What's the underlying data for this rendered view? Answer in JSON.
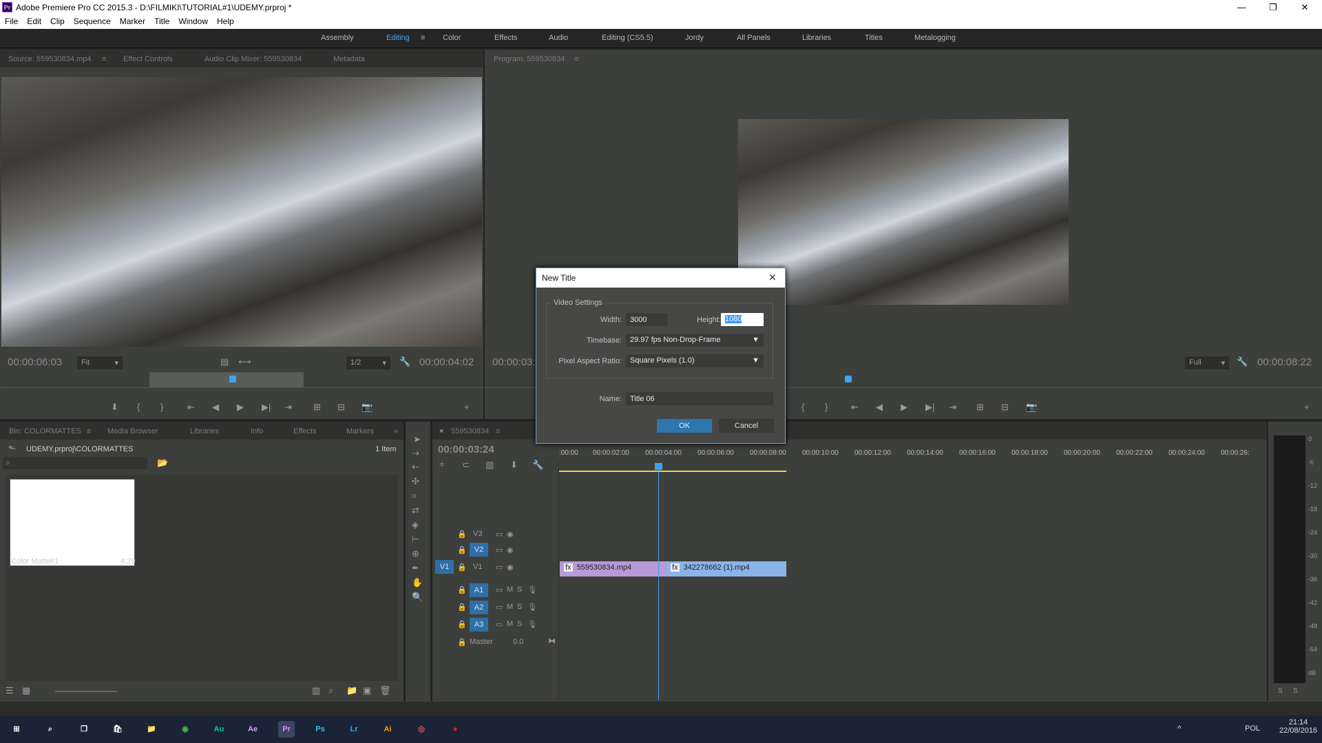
{
  "window": {
    "app_icon": "Pr",
    "title": "Adobe Premiere Pro CC 2015.3 - D:\\FILMIKI\\TUTORIAL#1\\UDEMY.prproj *",
    "minimize": "—",
    "restore": "❐",
    "close": "✕"
  },
  "menu": [
    "File",
    "Edit",
    "Clip",
    "Sequence",
    "Marker",
    "Title",
    "Window",
    "Help"
  ],
  "workspaces": {
    "items": [
      "Assembly",
      "Editing",
      "Color",
      "Effects",
      "Audio",
      "Editing (CS5.5)",
      "Jordy",
      "All Panels",
      "Libraries",
      "Titles",
      "Metalogging"
    ],
    "active": "Editing",
    "menu_icon": "≡"
  },
  "source_panel": {
    "tabs": [
      "Source: 559530834.mp4",
      "Effect Controls",
      "Audio Clip Mixer: 559530834",
      "Metadata"
    ],
    "tab_menu": "≡",
    "timecode_left": "00:00:06:03",
    "fit": "Fit",
    "resolution": "1/2",
    "timecode_right": "00:00:04:02",
    "playhead_fraction": 0.54
  },
  "program_panel": {
    "tab": "Program: 559530834",
    "tab_menu": "≡",
    "timecode_left": "00:00:03:",
    "fit": "Full",
    "timecode_right": "00:00:08:22"
  },
  "dialog": {
    "title": "New Title",
    "close": "✕",
    "group": "Video Settings",
    "width_label": "Width:",
    "width_value": "3000",
    "height_label": "Height:",
    "height_value": "1080",
    "timebase_label": "Timebase:",
    "timebase_value": "29.97 fps Non-Drop-Frame",
    "par_label": "Pixel Aspect Ratio:",
    "par_value": "Square Pixels (1.0)",
    "name_label": "Name:",
    "name_value": "Title 06",
    "ok": "OK",
    "cancel": "Cancel",
    "accent": "#2d77ad"
  },
  "project_panel": {
    "tabs": [
      "Bin: COLORMATTES",
      "Media Browser",
      "Libraries",
      "Info",
      "Effects",
      "Markers"
    ],
    "tab_menu": "≡",
    "overflow": "»",
    "path": "UDEMY.prproj\\COLORMATTES",
    "count": "1 Item",
    "items": [
      {
        "name": "Color Matte#1",
        "duration": "4:29",
        "color": "#ffffff"
      }
    ]
  },
  "timeline": {
    "tab": "559530834",
    "close": "×",
    "tab_menu": "≡",
    "timecode": "00:00:03:24",
    "ruler": [
      ":00:00",
      "00:00:02:00",
      "00:00:04:00",
      "00:00:06:00",
      "00:00:08:00",
      "00:00:10:00",
      "00:00:12:00",
      "00:00:14:00",
      "00:00:16:00",
      "00:00:18:00",
      "00:00:20:00",
      "00:00:22:00",
      "00:00:24:00",
      "00:00:26:"
    ],
    "video_tracks": [
      {
        "name": "V3",
        "target": false
      },
      {
        "name": "V2",
        "target": true
      },
      {
        "name": "V1",
        "target": true,
        "source": "V1"
      }
    ],
    "audio_tracks": [
      {
        "name": "A1",
        "m": "M",
        "s": "S"
      },
      {
        "name": "A2",
        "m": "M",
        "s": "S"
      },
      {
        "name": "A3",
        "m": "M",
        "s": "S"
      }
    ],
    "master": {
      "label": "Master",
      "value": "0.0"
    },
    "clips": [
      {
        "name": "559530834.mp4",
        "fx": "fx",
        "color": "#b89ad8"
      },
      {
        "name": "342278662 (1).mp4",
        "fx": "fx",
        "color": "#8ab4e8"
      }
    ]
  },
  "meter": {
    "scale": [
      "0",
      "-6",
      "-12",
      "-18",
      "-24",
      "-30",
      "-36",
      "-42",
      "-48",
      "-54",
      "dB"
    ],
    "solo": [
      "S",
      "S"
    ]
  },
  "taskbar": {
    "apps": [
      {
        "name": "start",
        "glyph": "⊞"
      },
      {
        "name": "search",
        "glyph": "⌕"
      },
      {
        "name": "task-view",
        "glyph": "❐"
      },
      {
        "name": "store",
        "glyph": "🛍"
      },
      {
        "name": "explorer",
        "glyph": "📁"
      },
      {
        "name": "chrome",
        "glyph": "◉"
      },
      {
        "name": "audition",
        "glyph": "Au"
      },
      {
        "name": "after-effects",
        "glyph": "Ae"
      },
      {
        "name": "premiere",
        "glyph": "Pr"
      },
      {
        "name": "photoshop",
        "glyph": "Ps"
      },
      {
        "name": "lightroom",
        "glyph": "Lr"
      },
      {
        "name": "illustrator",
        "glyph": "Ai"
      },
      {
        "name": "app-red",
        "glyph": "◎"
      },
      {
        "name": "record",
        "glyph": "●"
      }
    ],
    "lang": "POL",
    "time": "21:14",
    "date": "22/08/2016",
    "tray": "^"
  }
}
